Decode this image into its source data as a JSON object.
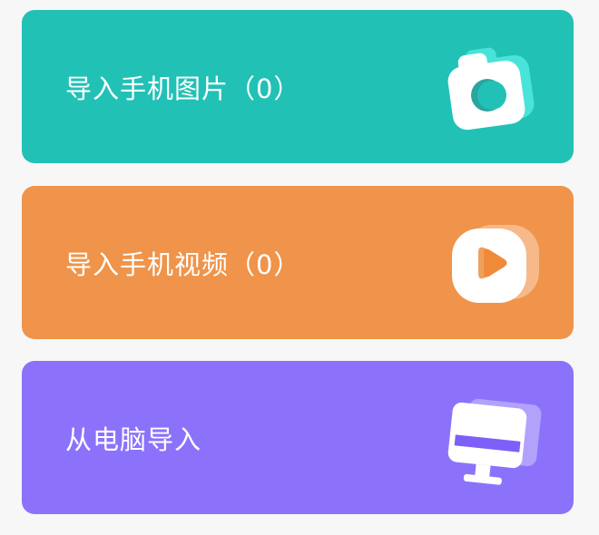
{
  "cards": [
    {
      "label": "导入手机图片（0）",
      "color": "#22c1b6",
      "icon": "camera-icon"
    },
    {
      "label": "导入手机视频（0）",
      "color": "#ef944a",
      "icon": "video-play-icon"
    },
    {
      "label": "从电脑导入",
      "color": "#8c72fb",
      "icon": "computer-monitor-icon"
    }
  ]
}
